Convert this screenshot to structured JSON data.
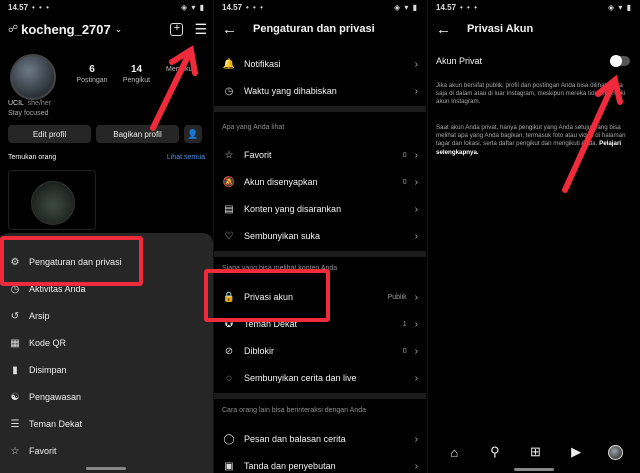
{
  "status": {
    "time": "14.57",
    "dots": "• • •",
    "icons": "◈ ▾ ▮"
  },
  "profile": {
    "username": "kocheng_2707",
    "stats": [
      {
        "num": "6",
        "label": "Postingan"
      },
      {
        "num": "14",
        "label": "Pengikut"
      },
      {
        "num": "",
        "label": "Mengikuti"
      }
    ],
    "name": "UCIL",
    "pronoun": "she/her",
    "bio": "Stay focused",
    "edit_label": "Edit profil",
    "share_label": "Bagikan profil",
    "discover_label": "Temukan orang",
    "see_all": "Lihat semua"
  },
  "sheet": {
    "items": [
      {
        "label": "Pengaturan dan privasi",
        "icon": "gear-icon"
      },
      {
        "label": "Aktivitas Anda",
        "icon": "activity-icon"
      },
      {
        "label": "Arsip",
        "icon": "archive-icon"
      },
      {
        "label": "Kode QR",
        "icon": "qr-icon"
      },
      {
        "label": "Disimpan",
        "icon": "bookmark-icon"
      },
      {
        "label": "Pengawasan",
        "icon": "supervision-icon"
      },
      {
        "label": "Teman Dekat",
        "icon": "list-icon"
      },
      {
        "label": "Favorit",
        "icon": "star-icon"
      }
    ]
  },
  "settings": {
    "title": "Pengaturan dan privasi",
    "rows_top": [
      {
        "label": "Notifikasi",
        "icon": "bell-icon"
      },
      {
        "label": "Waktu yang dihabiskan",
        "icon": "clock-icon"
      }
    ],
    "section1": "Apa yang Anda lihat",
    "rows_see": [
      {
        "label": "Favorit",
        "icon": "star-icon",
        "value": "0"
      },
      {
        "label": "Akun disenyapkan",
        "icon": "mute-icon",
        "value": "0"
      },
      {
        "label": "Konten yang disarankan",
        "icon": "content-icon",
        "value": ""
      },
      {
        "label": "Sembunyikan suka",
        "icon": "heart-off-icon",
        "value": ""
      }
    ],
    "section2": "Siapa yang bisa melihat konten Anda",
    "rows_who": [
      {
        "label": "Privasi akun",
        "icon": "lock-icon",
        "value": "Publik"
      },
      {
        "label": "Teman Dekat",
        "icon": "close-friends-icon",
        "value": "1"
      },
      {
        "label": "Diblokir",
        "icon": "block-icon",
        "value": "0"
      },
      {
        "label": "Sembunyikan cerita dan live",
        "icon": "story-off-icon",
        "value": ""
      }
    ],
    "section3": "Cara orang lain bisa berinteraksi dengan Anda",
    "rows_interact": [
      {
        "label": "Pesan dan balasan cerita",
        "icon": "message-icon"
      },
      {
        "label": "Tanda dan penyebutan",
        "icon": "tag-icon"
      }
    ]
  },
  "privacy": {
    "title": "Privasi Akun",
    "toggle_label": "Akun Privat",
    "toggle_on": false,
    "para1": "Jika akun bersifat publik, profil dan postingan Anda bisa dilihat siapa saja di dalam atau di luar Instagram, meskipun mereka tidak memiliki akun Instagram.",
    "para2": "Saat akun Anda privat, hanya pengikut yang Anda setujui yang bisa melihat apa yang Anda bagikan, termasuk foto atau video di halaman tagar dan lokasi, serta daftar pengikut dan mengikuti Anda.",
    "link": "Pelajari selengkapnya."
  },
  "colors": {
    "highlight": "#ef2b3b",
    "link": "#4a90e2",
    "sheet": "#262626"
  }
}
